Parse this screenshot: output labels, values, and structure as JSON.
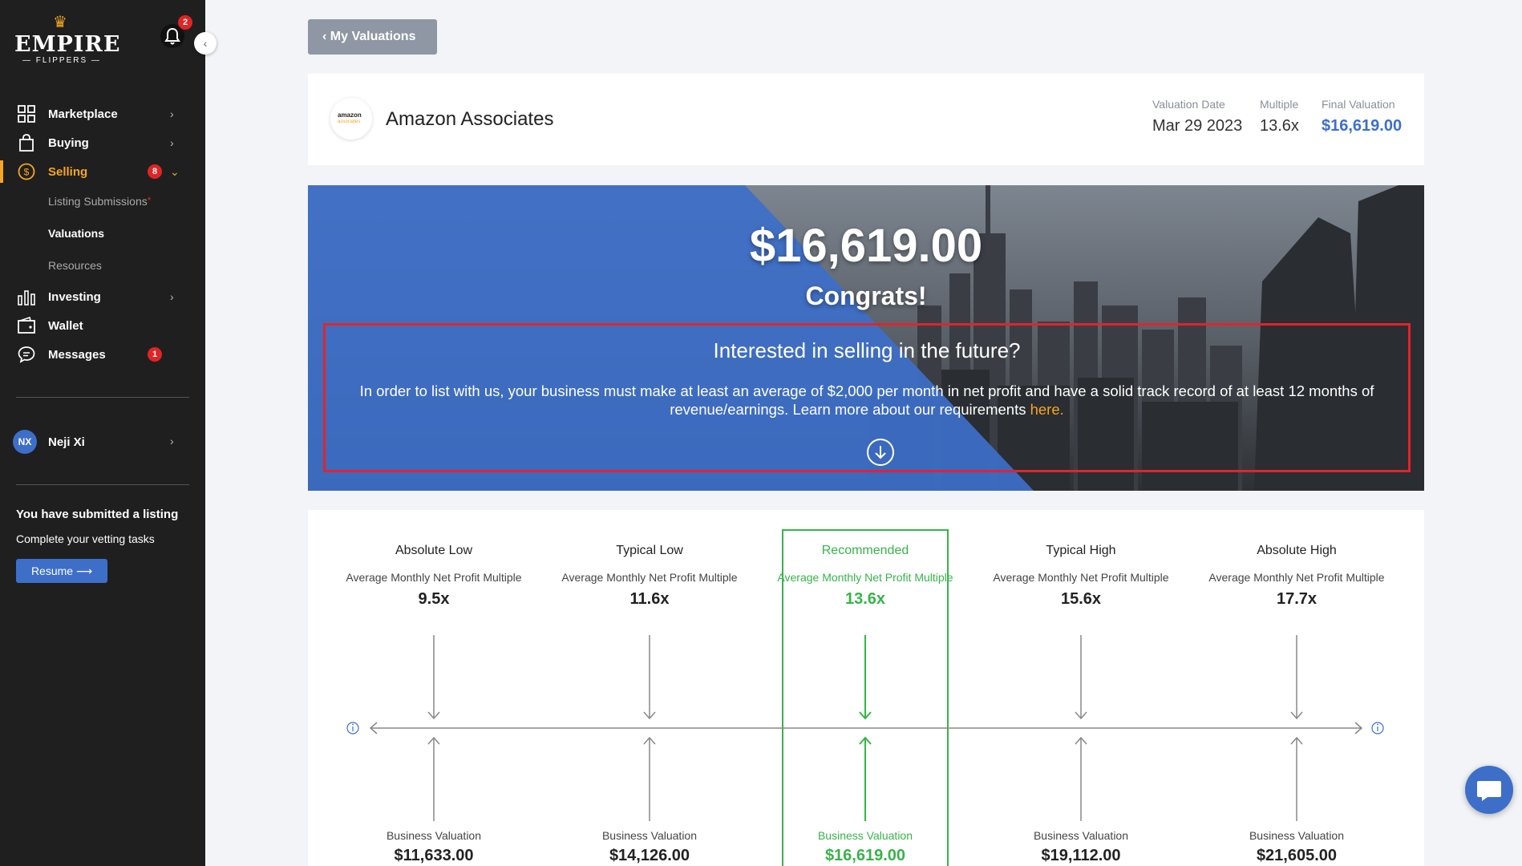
{
  "sidebar": {
    "logo": {
      "brand": "EMPIRE",
      "sub": "— FLIPPERS —"
    },
    "notifications_count": "2",
    "nav": [
      {
        "label": "Marketplace",
        "icon": "grid-icon"
      },
      {
        "label": "Buying",
        "icon": "shopping-bag-icon"
      },
      {
        "label": "Selling",
        "icon": "dollar-circle-icon",
        "badge": "8",
        "active": true
      },
      {
        "label": "Investing",
        "icon": "bar-chart-icon"
      },
      {
        "label": "Wallet",
        "icon": "wallet-icon"
      },
      {
        "label": "Messages",
        "icon": "chat-bubble-icon",
        "badge": "1"
      }
    ],
    "selling_sub": [
      {
        "label": "Listing Submissions",
        "marker": "*"
      },
      {
        "label": "Valuations",
        "current": true
      },
      {
        "label": "Resources"
      }
    ],
    "user": {
      "initials": "NX",
      "name": "Neji Xi"
    },
    "listing_notice": {
      "title": "You have submitted a listing",
      "subtitle": "Complete your vetting tasks",
      "button": "Resume"
    }
  },
  "main": {
    "back_button": "My Valuations",
    "header": {
      "business_name": "Amazon Associates",
      "logo_text": "amazon",
      "logo_subtext": "associates",
      "valuation_date_label": "Valuation Date",
      "valuation_date": "Mar 29 2023",
      "multiple_label": "Multiple",
      "multiple": "13.6x",
      "final_valuation_label": "Final Valuation",
      "final_valuation": "$16,619.00"
    },
    "hero": {
      "amount": "$16,619.00",
      "congrats": "Congrats!",
      "question": "Interested in selling in the future?",
      "text": "In order to list with us, your business must make at least an average of $2,000 per month in net profit and have a solid track record of at least 12 months of revenue/earnings. Learn more about our requirements",
      "link": "here."
    },
    "ranges": {
      "multiple_label": "Average Monthly Net Profit Multiple",
      "valuation_label": "Business Valuation",
      "columns": [
        {
          "title": "Absolute Low",
          "multiple": "9.5x",
          "valuation": "$11,633.00"
        },
        {
          "title": "Typical Low",
          "multiple": "11.6x",
          "valuation": "$14,126.00"
        },
        {
          "title": "Recommended",
          "multiple": "13.6x",
          "valuation": "$16,619.00",
          "recommended": true
        },
        {
          "title": "Typical High",
          "multiple": "15.6x",
          "valuation": "$19,112.00"
        },
        {
          "title": "Absolute High",
          "multiple": "17.7x",
          "valuation": "$21,605.00"
        }
      ]
    }
  },
  "colors": {
    "accent": "#f5a623",
    "primary": "#3d6fc9",
    "recommended": "#37b34a",
    "alert": "#e02424"
  }
}
